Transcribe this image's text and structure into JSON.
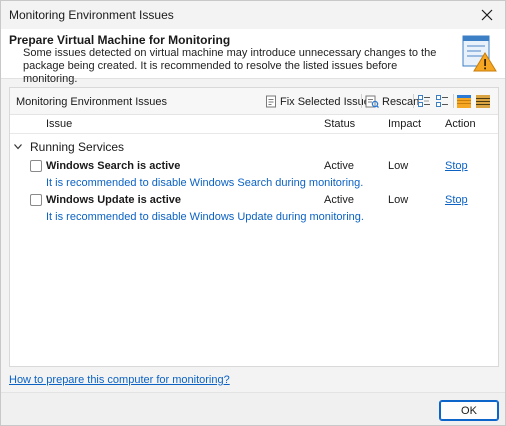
{
  "window": {
    "title": "Monitoring Environment Issues"
  },
  "header": {
    "title": "Prepare Virtual Machine for Monitoring",
    "description": "Some issues detected on virtual machine may introduce unnecessary changes to the package being created. It is recommended to resolve the listed issues before monitoring.",
    "icon": "warning-document-icon"
  },
  "panel": {
    "title": "Monitoring Environment Issues",
    "toolbar": {
      "fix_label": "Fix Selected Issues",
      "rescan_label": "Rescan",
      "icons": [
        "fix-icon",
        "rescan-icon",
        "expand-all-icon",
        "collapse-all-icon",
        "view-color-icon",
        "view-list-icon"
      ]
    },
    "columns": {
      "issue": "Issue",
      "status": "Status",
      "impact": "Impact",
      "action": "Action"
    },
    "group": {
      "label": "Running Services"
    },
    "rows": [
      {
        "name": "Windows Search is active",
        "status": "Active",
        "impact": "Low",
        "action": "Stop",
        "note": "It is recommended to disable Windows Search during monitoring."
      },
      {
        "name": "Windows Update is active",
        "status": "Active",
        "impact": "Low",
        "action": "Stop",
        "note": "It is recommended to disable Windows Update during monitoring."
      }
    ]
  },
  "help_link": "How to prepare this computer for monitoring?",
  "footer": {
    "ok_label": "OK"
  },
  "colors": {
    "link": "#0b62c4",
    "accent": "#0a64c9",
    "warning": "#f5a623"
  }
}
